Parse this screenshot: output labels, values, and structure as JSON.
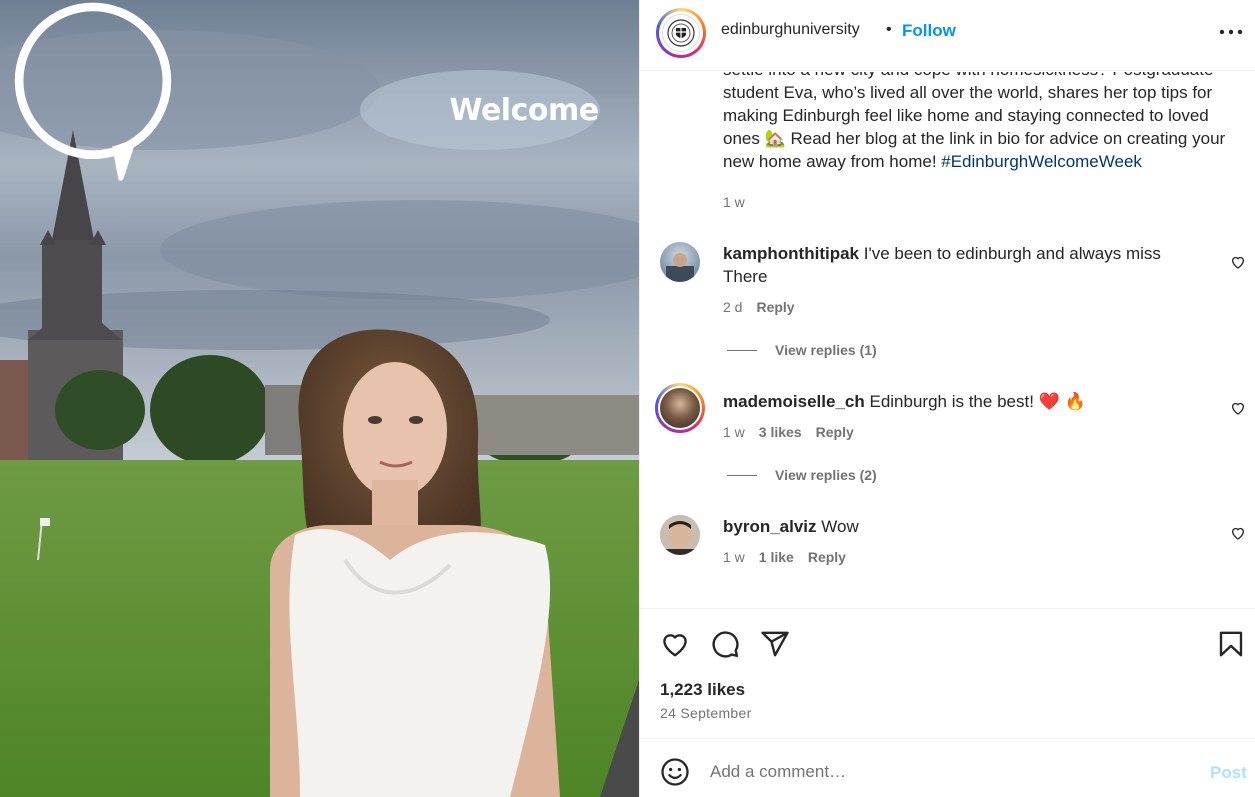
{
  "photo": {
    "sticker_text": "Welcome"
  },
  "header": {
    "username": "edinburghuniversity",
    "separator": "•",
    "follow_label": "Follow",
    "more_icon": "more-horizontal-icon"
  },
  "caption": {
    "text": "settle into a new city and cope with homesickness? Postgraduate student Eva, who’s lived all over the world, shares her top tips for making Edinburgh feel like home and staying connected to loved ones 🏡 Read her blog at the link in bio for advice on creating your new home away from home! ",
    "hashtag": "#EdinburghWelcomeWeek",
    "time": "1 w"
  },
  "comments": [
    {
      "username": "kamphonthitipak",
      "text": "I've been to edinburgh and always miss There",
      "time": "2 d",
      "likes": "",
      "reply_label": "Reply",
      "view_replies": "View replies (1)"
    },
    {
      "username": "mademoiselle_ch",
      "text": "Edinburgh is the best! ❤️ 🔥",
      "time": "1 w",
      "likes": "3 likes",
      "reply_label": "Reply",
      "view_replies": "View replies (2)"
    },
    {
      "username": "byron_alviz",
      "text": "Wow",
      "time": "1 w",
      "likes": "1 like",
      "reply_label": "Reply",
      "view_replies": ""
    }
  ],
  "actions": {
    "icons": [
      "heart-icon",
      "comment-icon",
      "share-icon",
      "bookmark-icon"
    ],
    "likes": "1,223 likes",
    "date": "24 September"
  },
  "add_comment": {
    "placeholder": "Add a comment…",
    "post_label": "Post",
    "emoji_icon": "emoji-icon"
  },
  "colors": {
    "accent": "#0095f6",
    "hashtag": "#00376b",
    "muted": "#737373",
    "post_disabled": "#b2dffc"
  }
}
